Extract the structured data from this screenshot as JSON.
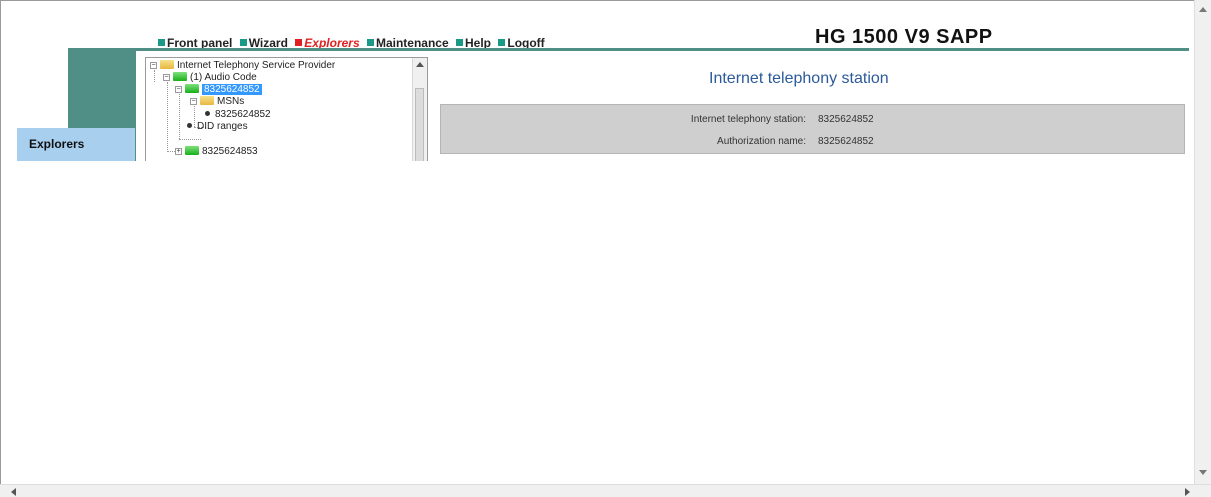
{
  "brand": {
    "title": "HG 1500 V9 SAPP"
  },
  "nav": {
    "front_panel": "Front panel",
    "wizard": "Wizard",
    "explorers": "Explorers",
    "maintenance": "Maintenance",
    "help": "Help",
    "logoff": "Logoff",
    "active": "Explorers"
  },
  "sidebar": {
    "explorers_label": "Explorers"
  },
  "tree": {
    "nodes": [
      {
        "label": "Internet Telephony Service Provider",
        "expanded": true,
        "icon": "yellow-folder-icon"
      },
      {
        "label": "(1) Audio Code",
        "expanded": true,
        "icon": "green-folder-icon"
      },
      {
        "label": "8325624852",
        "expanded": true,
        "selected": true,
        "icon": "green-folder-icon"
      },
      {
        "label": "MSNs",
        "expanded": true,
        "icon": "yellow-folder-icon"
      },
      {
        "label": "8325624852",
        "icon": "bullet-icon"
      },
      {
        "label": "DID ranges",
        "icon": "bullet-icon"
      },
      {
        "label": "8325624853",
        "expanded": false,
        "icon": "green-folder-icon"
      }
    ]
  },
  "main": {
    "title": "Internet telephony station",
    "fields": [
      {
        "label": "Internet telephony station:",
        "value": "8325624852"
      },
      {
        "label": "Authorization name:",
        "value": "8325624852"
      }
    ]
  },
  "colors": {
    "accent": "#4f8f86",
    "nav_square": "#1a9a86",
    "active": "#e02020",
    "title": "#2c5a9a",
    "selection": "#3399ff",
    "sidebar_tab": "#a9cfee"
  }
}
